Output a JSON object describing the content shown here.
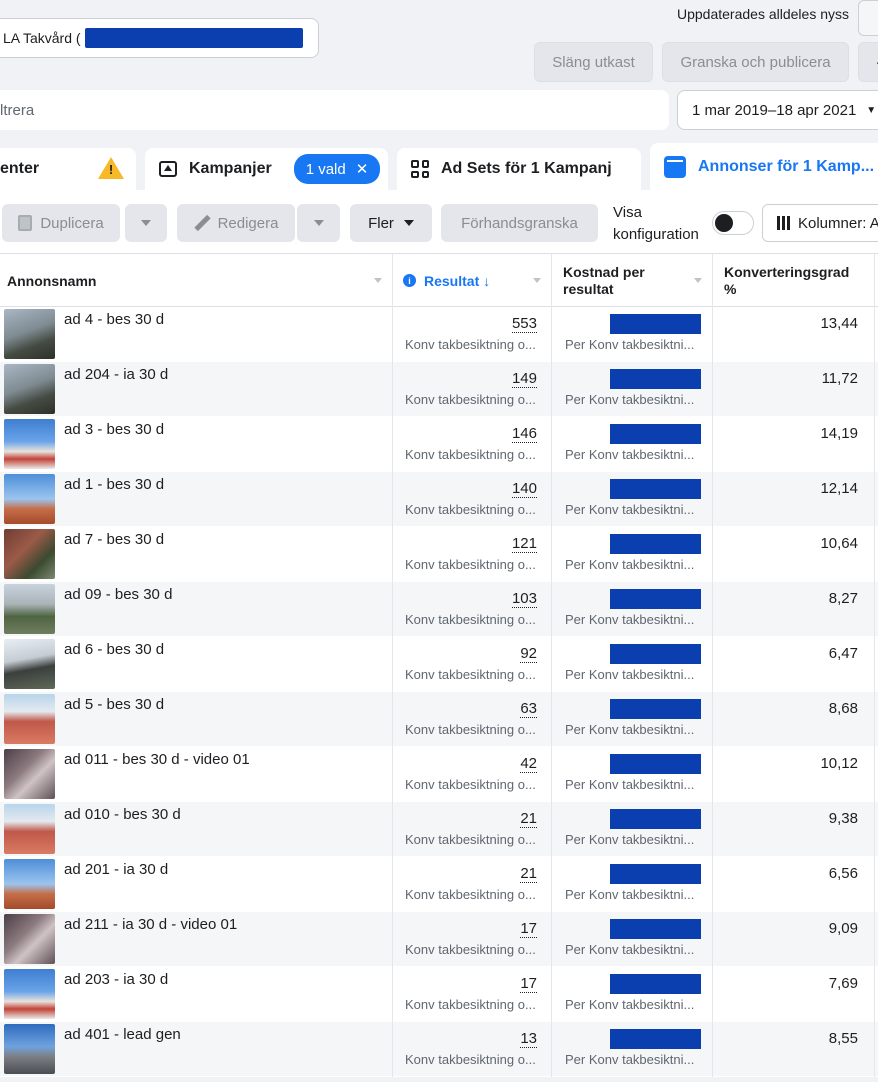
{
  "header": {
    "account_name": "LA Takvård (",
    "updated_text": "Uppdaterades alldeles nyss",
    "discard_label": "Släng utkast",
    "publish_label": "Granska och publicera",
    "more_label": "·"
  },
  "filter": {
    "placeholder": "ltrera",
    "date_range": "1 mar 2019–18 apr 2021"
  },
  "tabs": {
    "center": "enter",
    "campaigns": "Kampanjer",
    "selected_chip": "1 vald",
    "adsets": "Ad Sets för 1 Kampanj",
    "ads": "Annonser för 1 Kamp..."
  },
  "toolbar": {
    "duplicate": "Duplicera",
    "edit": "Redigera",
    "more": "Fler",
    "preview": "Förhandsgranska",
    "visa_line1": "Visa",
    "visa_line2": "konfiguration",
    "columns": "Kolumner: A"
  },
  "table": {
    "columns": {
      "name": "Annonsnamn",
      "result": "Resultat",
      "result_arrow": "↓",
      "cost_line1": "Kostnad per",
      "cost_line2": "resultat",
      "conv_line1": "Konverteringsgrad",
      "conv_line2": "%"
    },
    "result_sub": "Konv takbesiktning o...",
    "cost_sub": "Per Konv takbesiktni...",
    "rows": [
      {
        "name": "ad 4 - bes 30 d",
        "result": "553",
        "conv": "13,44",
        "thumb": "a"
      },
      {
        "name": "ad 204 - ia 30 d",
        "result": "149",
        "conv": "11,72",
        "thumb": "a"
      },
      {
        "name": "ad 3 - bes 30 d",
        "result": "146",
        "conv": "14,19",
        "thumb": "b"
      },
      {
        "name": "ad 1 - bes 30 d",
        "result": "140",
        "conv": "12,14",
        "thumb": "c"
      },
      {
        "name": "ad 7 - bes 30 d",
        "result": "121",
        "conv": "10,64",
        "thumb": "d"
      },
      {
        "name": "ad 09 - bes 30 d",
        "result": "103",
        "conv": "8,27",
        "thumb": "e"
      },
      {
        "name": "ad 6 - bes 30 d",
        "result": "92",
        "conv": "6,47",
        "thumb": "f"
      },
      {
        "name": "ad 5 - bes 30 d",
        "result": "63",
        "conv": "8,68",
        "thumb": "g"
      },
      {
        "name": "ad 011 - bes 30 d - video 01",
        "result": "42",
        "conv": "10,12",
        "thumb": "h"
      },
      {
        "name": "ad 010 - bes 30 d",
        "result": "21",
        "conv": "9,38",
        "thumb": "g"
      },
      {
        "name": "ad 201 - ia 30 d",
        "result": "21",
        "conv": "6,56",
        "thumb": "c"
      },
      {
        "name": "ad 211 - ia 30 d - video 01",
        "result": "17",
        "conv": "9,09",
        "thumb": "h"
      },
      {
        "name": "ad 203 - ia 30 d",
        "result": "17",
        "conv": "7,69",
        "thumb": "b"
      },
      {
        "name": "ad 401 - lead gen",
        "result": "13",
        "conv": "8,55",
        "thumb": "i"
      }
    ]
  },
  "colors": {
    "accent": "#1877f2",
    "redaction": "#0b3fb0",
    "warning": "#f7b928"
  }
}
